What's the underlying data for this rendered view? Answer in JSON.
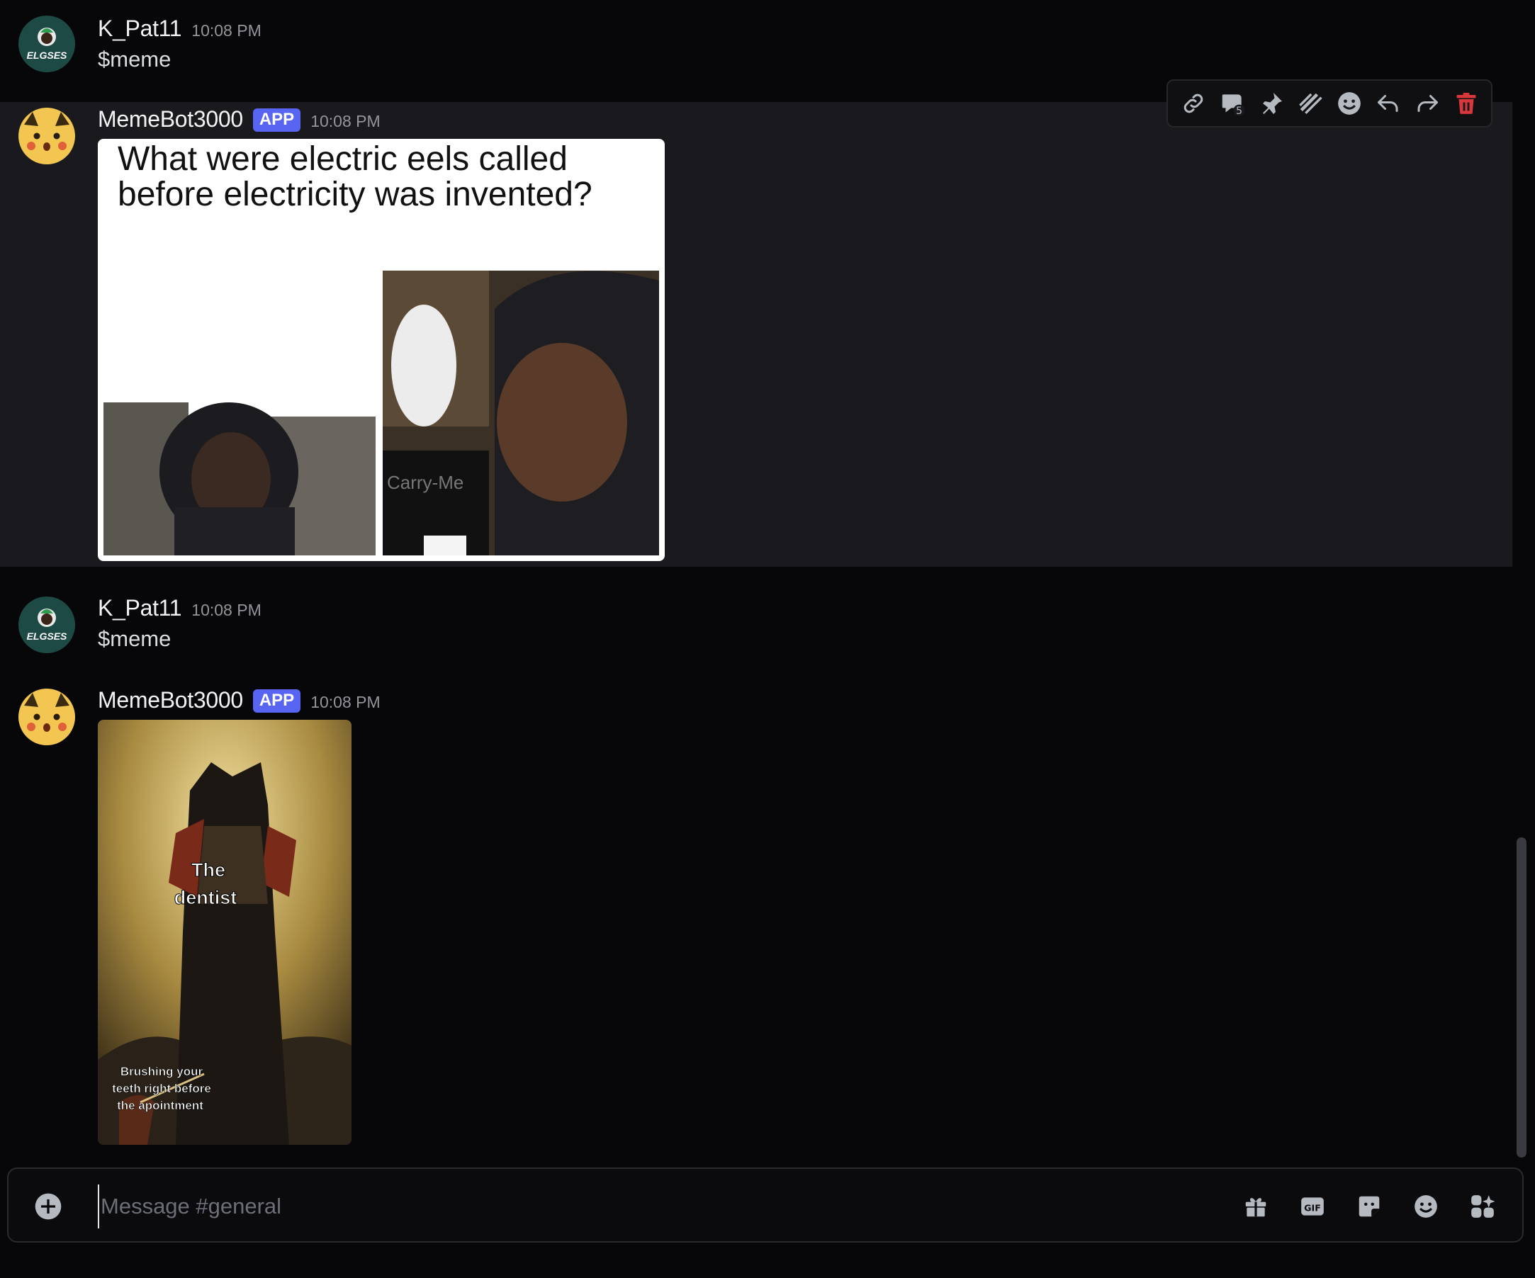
{
  "messages": [
    {
      "author": "K_Pat11",
      "time": "10:08 PM",
      "text": "$meme",
      "avatar_text": "ELGSES"
    },
    {
      "author": "MemeBot3000",
      "badge": "APP",
      "time": "10:08 PM",
      "image": {
        "caption_line1": "What were electric eels called",
        "caption_line2": "before electricity was invented?",
        "sign_text": "Carry-Me"
      }
    },
    {
      "author": "K_Pat11",
      "time": "10:08 PM",
      "text": "$meme",
      "avatar_text": "ELGSES"
    },
    {
      "author": "MemeBot3000",
      "badge": "APP",
      "time": "10:08 PM",
      "image": {
        "label_big_1": "The",
        "label_big_2": "dentist",
        "label_small_1": "Brushing your",
        "label_small_2": "teeth right before",
        "label_small_3": "the apointment"
      }
    }
  ],
  "toolbar": [
    "link-icon",
    "thread-icon",
    "pin-icon",
    "apps-icon",
    "emoji-icon",
    "reply-icon",
    "forward-icon",
    "delete-icon"
  ],
  "composer": {
    "placeholder": "Message #general",
    "value": ""
  },
  "colors": {
    "accent": "#5865f2",
    "danger": "#da373c",
    "background": "#070709",
    "hover": "#1a1a1e"
  }
}
